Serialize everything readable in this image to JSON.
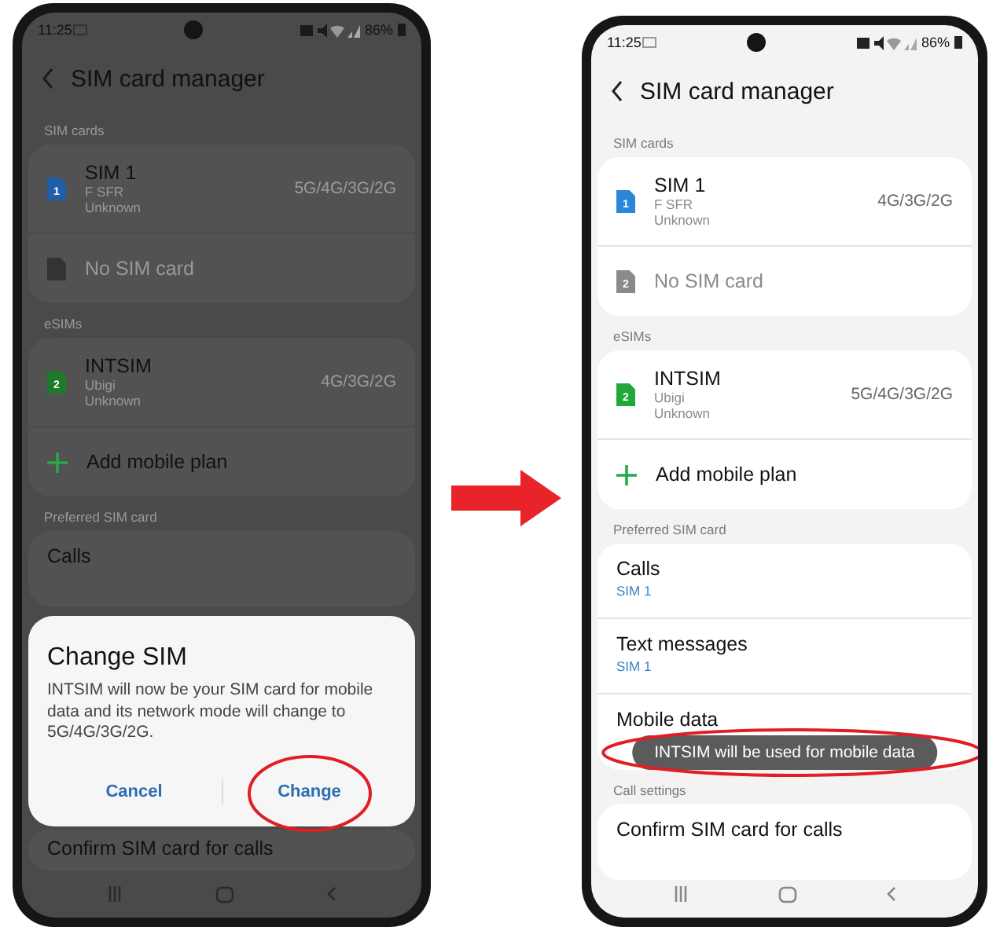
{
  "phones": [
    {
      "dimmed": true,
      "status_bar": {
        "time": "11:25",
        "battery": "86%"
      },
      "title": "SIM card manager",
      "groups": [
        {
          "header": "SIM cards",
          "items": [
            {
              "kind": "sim",
              "name": "SIM 1",
              "badge": "1",
              "color": "#1f5fa8",
              "lines": [
                "F SFR",
                "Unknown"
              ],
              "network": "5G/4G/3G/2G"
            },
            {
              "kind": "empty",
              "name": "No SIM card",
              "color": "#333333"
            }
          ]
        },
        {
          "header": "eSIMs",
          "items": [
            {
              "kind": "sim",
              "name": "INTSIM",
              "badge": "2",
              "color": "#1d7a2a",
              "lines": [
                "Ubigi",
                "Unknown"
              ],
              "network": "4G/3G/2G"
            },
            {
              "kind": "add",
              "name": "Add mobile plan"
            }
          ]
        },
        {
          "header": "Preferred SIM card",
          "items": [
            {
              "kind": "setting",
              "name": "Calls"
            }
          ]
        },
        {
          "items": [
            {
              "kind": "setting",
              "name": "Confirm SIM card for calls"
            }
          ]
        }
      ],
      "dialog": {
        "title": "Change SIM",
        "message": "INTSIM will now be your  SIM card for mobile data and its network mode will change to 5G/4G/3G/2G.",
        "buttons": [
          {
            "label": "Cancel",
            "highlighted": false
          },
          {
            "label": "Change",
            "highlighted": true
          }
        ]
      }
    },
    {
      "dimmed": false,
      "status_bar": {
        "time": "11:25",
        "battery": "86%"
      },
      "title": "SIM card manager",
      "groups": [
        {
          "header": "SIM cards",
          "items": [
            {
              "kind": "sim",
              "name": "SIM 1",
              "badge": "1",
              "color": "#2a86d8",
              "lines": [
                "F SFR",
                "Unknown"
              ],
              "network": "4G/3G/2G"
            },
            {
              "kind": "empty",
              "name": "No SIM card",
              "badge": "2",
              "color": "#8a8a8a"
            }
          ]
        },
        {
          "header": "eSIMs",
          "items": [
            {
              "kind": "sim",
              "name": "INTSIM",
              "badge": "2",
              "color": "#22a83a",
              "lines": [
                "Ubigi",
                "Unknown"
              ],
              "network": "5G/4G/3G/2G"
            },
            {
              "kind": "add",
              "name": "Add mobile plan"
            }
          ]
        },
        {
          "header": "Preferred SIM card",
          "items": [
            {
              "kind": "setting",
              "name": "Calls",
              "value": "SIM 1"
            },
            {
              "kind": "setting",
              "name": "Text messages",
              "value": "SIM 1"
            },
            {
              "kind": "setting",
              "name": "Mobile data"
            }
          ]
        },
        {
          "header": "Call settings",
          "items": [
            {
              "kind": "setting",
              "name": "Confirm SIM card for calls"
            }
          ]
        }
      ],
      "toast": {
        "text": "INTSIM will be used for mobile data",
        "highlighted": true
      }
    }
  ]
}
